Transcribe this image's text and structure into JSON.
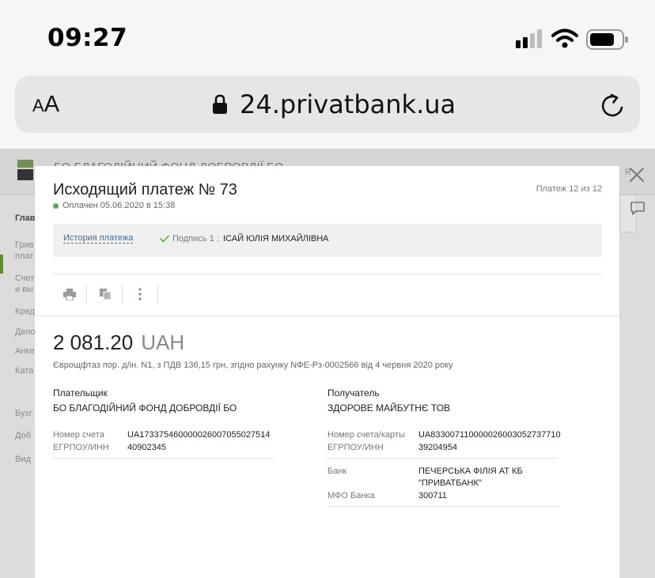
{
  "status_bar": {
    "time": "09:27"
  },
  "browser": {
    "aa_small": "A",
    "aa_large": "A",
    "url": "24.privatbank.ua"
  },
  "background": {
    "company": "БО БЛАГОДІЙНИЙ ФОНД ДОБРОВДІЇ БО",
    "right_label": "R",
    "sidebar_items": [
      "Глав",
      "Грив",
      "плат",
      "Счет",
      "и вы",
      "Кред",
      "Депо",
      "Анке",
      "Ката",
      "Бухг",
      "Доб",
      "Вид"
    ]
  },
  "payment": {
    "title": "Исходящий платеж № 73",
    "counter": "Платеж 12 из 12",
    "status": "Оплачен 05.06.2020 в 15:38",
    "status_color": "#4caf50",
    "history_link": "История платежа",
    "signature_label": "Подпись 1 :",
    "signature_name": "ІСАЙ ЮЛІЯ МИХАЙЛІВНА",
    "amount": "2 081.20",
    "currency": "UAH",
    "purpose": "Єврощфтаз пор. д/ін. N1, з ПДВ 136,15 грн, згідно рахунку NФЕ-Рз-0002566 від 4 червня 2020 року"
  },
  "payer": {
    "heading": "Плательщик",
    "name": "БО БЛАГОДІЙНИЙ ФОНД ДОБРОВДІЇ БО",
    "account_label": "Номер счета",
    "account": "UA173375460000026007055027514",
    "edrpou_label": "ЕГРПОУ/ИНН",
    "edrpou": "40902345"
  },
  "recipient": {
    "heading": "Получатель",
    "name": "ЗДОРОВЕ МАЙБУТНЄ ТОВ",
    "account_label": "Номер счета/карты",
    "account": "UA833007110000026003052737710",
    "edrpou_label": "ЕГРПОУ/ИНН",
    "edrpou": "39204954",
    "bank_label": "Банк",
    "bank_line1": "ПЕЧЕРСЬКА ФІЛІЯ АТ КБ",
    "bank_line2": "\"ПРИВАТБАНК\"",
    "mfo_label": "МФО Банка",
    "mfo": "300711"
  },
  "icons": {
    "print": "printer-icon",
    "copy": "copy-icon",
    "more": "more-vertical-icon",
    "close": "close-icon",
    "chat": "chat-icon",
    "lock": "lock-icon",
    "reload": "reload-icon"
  }
}
